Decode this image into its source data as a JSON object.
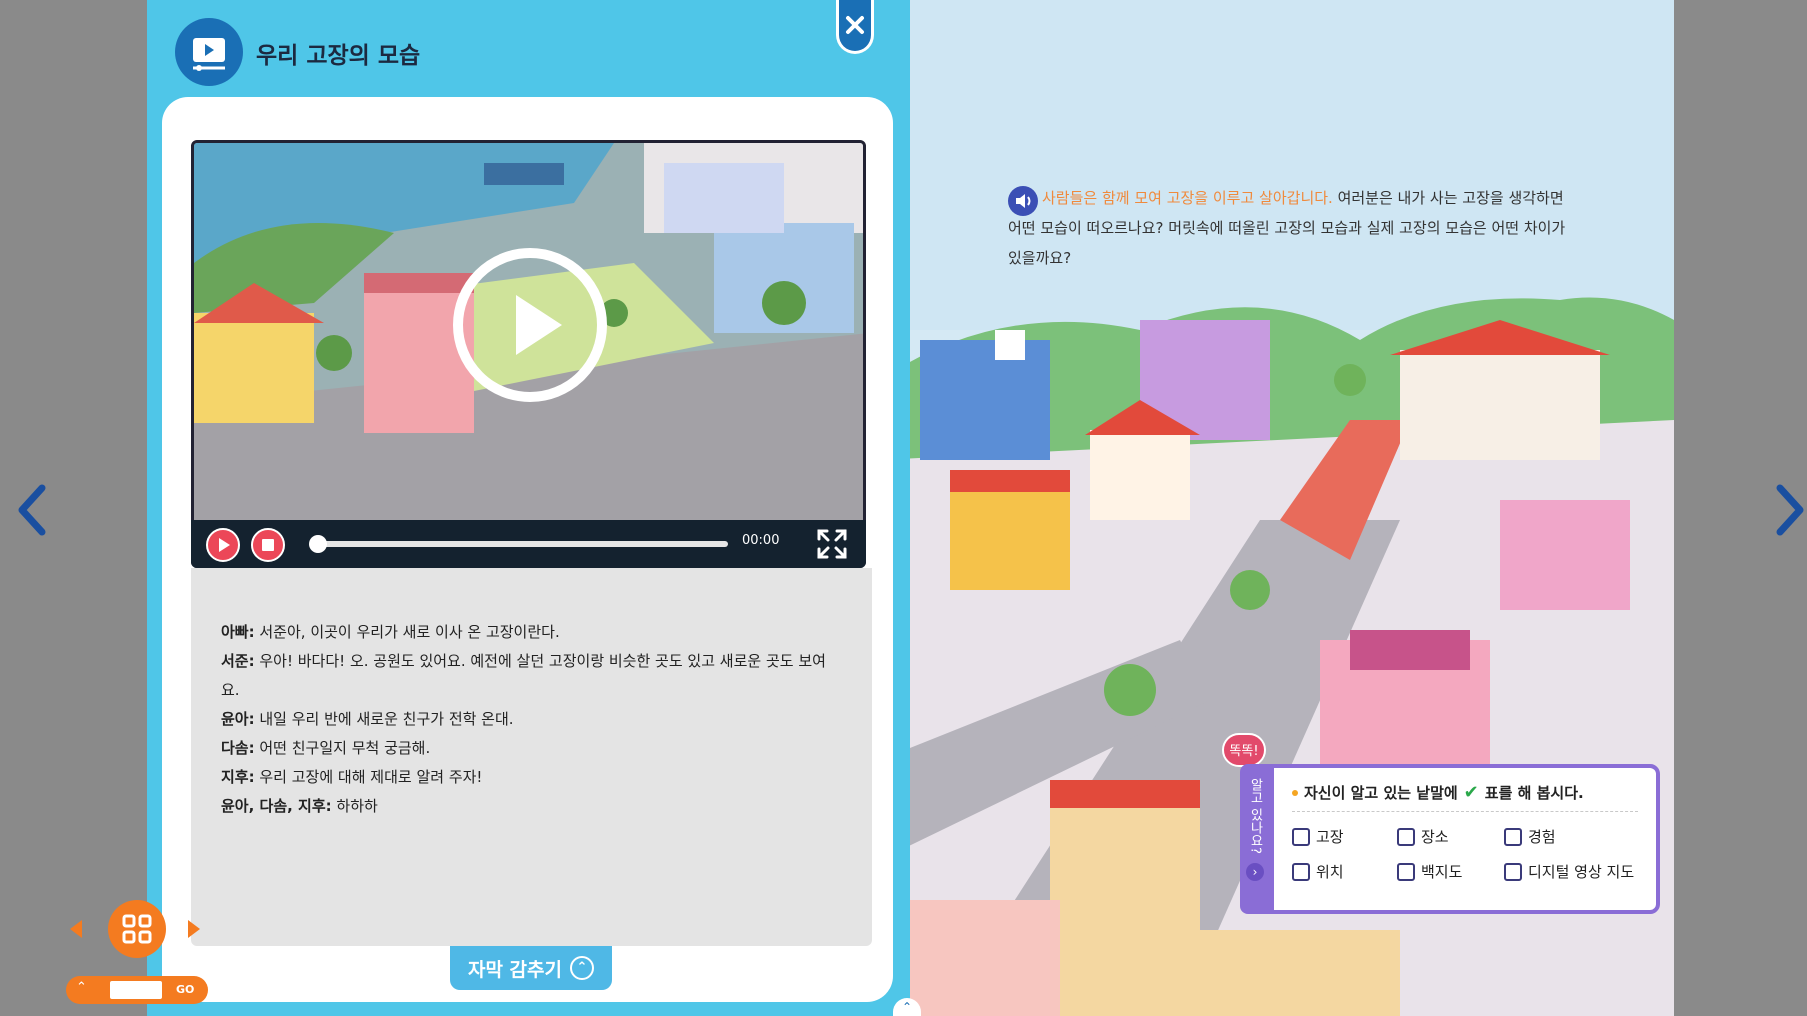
{
  "modal": {
    "title": "우리 고장의 모습",
    "close_icon": "close-icon",
    "time": "00:00",
    "progress": 0,
    "hide_subtitle_label": "자막 감추기",
    "subtitles": [
      {
        "speaker": "아빠:",
        "text": " 서준아, 이곳이 우리가 새로 이사 온 고장이란다."
      },
      {
        "speaker": "서준:",
        "text": " 우아! 바다다! 오. 공원도 있어요. 예전에 살던 고장이랑 비슷한 곳도 있고 새로운 곳도 보여요."
      },
      {
        "speaker": "윤아:",
        "text": " 내일 우리 반에 새로운 친구가 전학 온대."
      },
      {
        "speaker": "다솜:",
        "text": " 어떤 친구일지 무척 궁금해."
      },
      {
        "speaker": "지후:",
        "text": " 우리 고장에 대해 제대로 알려 주자!"
      },
      {
        "speaker": "윤아, 다솜, 지후:",
        "text": " 하하하"
      }
    ]
  },
  "book": {
    "intro_highlight": "사람들은 함께 모여 고장을 이루고 살아갑니다.",
    "intro_rest": " 여러분은 내가 사는 고장을 생각하면 어떤 모습이 떠오르나요? 머릿속에 떠올린 고장의 모습과 실제 고장의 모습은 어떤 차이가 있을까요?",
    "badge": "똑똑!",
    "quiz_side": "알고 있나요?",
    "quiz_title_a": "자신이 알고 있는 낱말에",
    "quiz_title_b": "표를 해 봅시다.",
    "quiz_items": [
      "고장",
      "장소",
      "경험",
      "위치",
      "백지도",
      "디지털 영상 지도"
    ]
  },
  "nav": {
    "go_label": "GO",
    "page_value": ""
  },
  "colors": {
    "accent": "#4fc6e8",
    "brand_blue": "#1a6fb5",
    "orange": "#f47b20",
    "quiz_purple": "#8a6dd6"
  }
}
